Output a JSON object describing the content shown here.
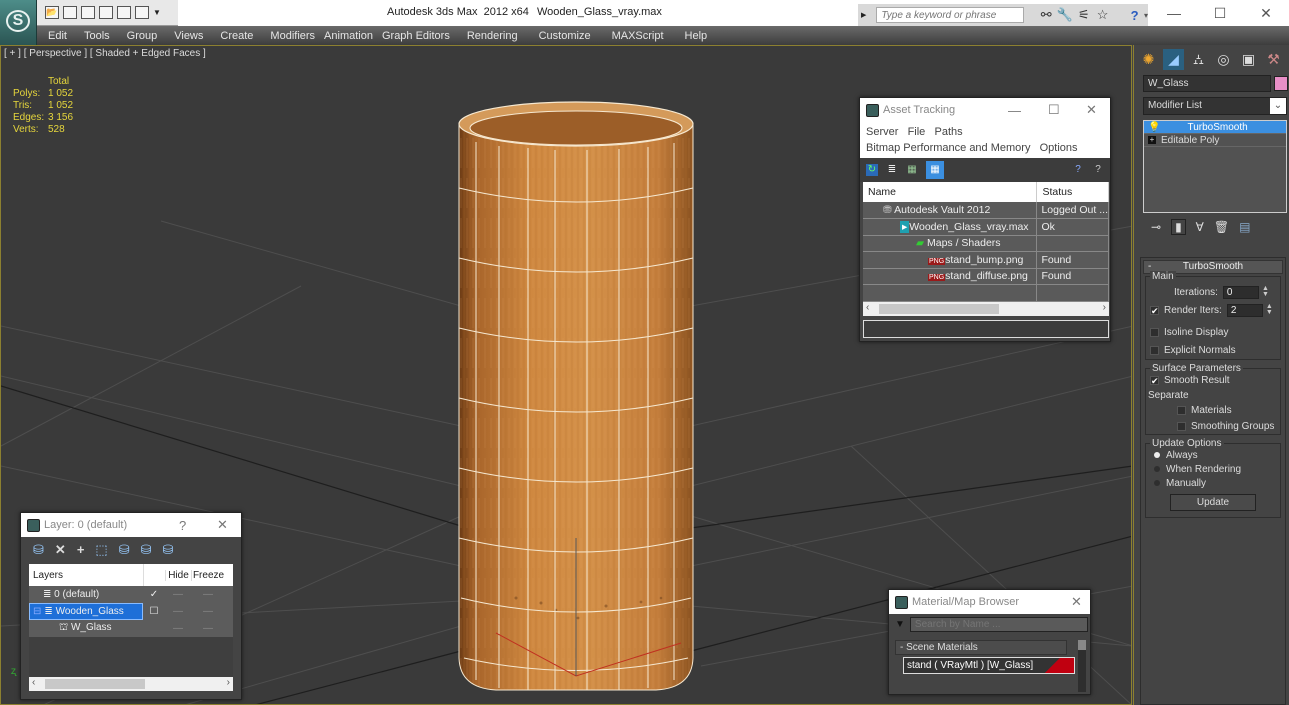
{
  "titlebar": {
    "app_title": "Autodesk 3ds Max  2012 x64",
    "file_name": "Wooden_Glass_vray.max",
    "search_placeholder": "Type a keyword or phrase",
    "qat_icons": [
      "open-icon",
      "save-icon",
      "new-icon",
      "hold-icon",
      "undo-icon",
      "redo-icon",
      "dropdown-icon"
    ],
    "infocenter_icons": [
      "binoculars-icon",
      "wrench-icon",
      "satellite-icon",
      "star-icon",
      "help-icon"
    ],
    "minimize": "—",
    "maximize": "☐",
    "close": "✕"
  },
  "menubar": {
    "items": [
      "Edit",
      "Tools",
      "Group",
      "Views",
      "Create",
      "Modifiers",
      "Animation",
      "Graph Editors",
      "Rendering",
      "Customize",
      "MAXScript",
      "Help"
    ]
  },
  "viewport": {
    "label": "[ + ] [ Perspective ] [ Shaded + Edged Faces ]",
    "stats": {
      "header": "Total",
      "rows": [
        {
          "key": "Polys:",
          "value": "1 052"
        },
        {
          "key": "Tris:",
          "value": "1 052"
        },
        {
          "key": "Edges:",
          "value": "3 156"
        },
        {
          "key": "Verts:",
          "value": "528"
        }
      ]
    },
    "colors": {
      "background": "#3a3a3a",
      "wood": "#c8803a",
      "wire": "#f4e4c8",
      "stats": "#e6d63c"
    }
  },
  "asset_tracking": {
    "title": "Asset Tracking",
    "menu_row1": [
      "Server",
      "File",
      "Paths"
    ],
    "menu_row2": [
      "Bitmap Performance and Memory",
      "Options"
    ],
    "columns": [
      "Name",
      "Status"
    ],
    "rows": [
      {
        "name": "Autodesk Vault 2012",
        "status": "Logged Out ...",
        "icon": "vault-icon",
        "indent": 1
      },
      {
        "name": "Wooden_Glass_vray.max",
        "status": "Ok",
        "icon": "max-file-icon",
        "indent": 2
      },
      {
        "name": "Maps / Shaders",
        "status": "",
        "icon": "maps-folder-icon",
        "indent": 3
      },
      {
        "name": "stand_bump.png",
        "status": "Found",
        "icon": "png-icon",
        "indent": 4
      },
      {
        "name": "stand_diffuse.png",
        "status": "Found",
        "icon": "png-icon",
        "indent": 4
      }
    ]
  },
  "command_panel": {
    "object_name": "W_Glass",
    "object_color": "#e88fc7",
    "modifier_list": "Modifier List",
    "stack": [
      {
        "label": "TurboSmooth",
        "selected": true
      },
      {
        "label": "Editable Poly",
        "selected": false
      }
    ],
    "rollout": {
      "title": "TurboSmooth",
      "main_label": "Main",
      "iterations_label": "Iterations:",
      "iterations_value": "0",
      "render_iters_label": "Render Iters:",
      "render_iters_value": "2",
      "render_iters_checked": true,
      "isoline_label": "Isoline Display",
      "explicit_normals_label": "Explicit Normals",
      "surface_label": "Surface Parameters",
      "smooth_result_label": "Smooth Result",
      "separate_label": "Separate",
      "materials_label": "Materials",
      "smoothing_groups_label": "Smoothing Groups",
      "update_options_label": "Update Options",
      "radio_options": [
        "Always",
        "When Rendering",
        "Manually"
      ],
      "radio_selected": "Always",
      "update_button": "Update"
    }
  },
  "layer_window": {
    "title": "Layer: 0 (default)",
    "help": "?",
    "close": "✕",
    "columns": [
      "Layers",
      "",
      "Hide",
      "Freeze"
    ],
    "rows": [
      {
        "name": "0 (default)",
        "current": true,
        "selected": false,
        "indent": 1
      },
      {
        "name": "Wooden_Glass",
        "current": false,
        "selected": true,
        "indent": 0
      },
      {
        "name": "W_Glass",
        "current": false,
        "selected": false,
        "indent": 2
      }
    ]
  },
  "material_browser": {
    "title": "Material/Map Browser",
    "close": "✕",
    "search_placeholder": "Search by Name ...",
    "category": "- Scene Materials",
    "material": "stand  ( VRayMtl ) [W_Glass]"
  }
}
